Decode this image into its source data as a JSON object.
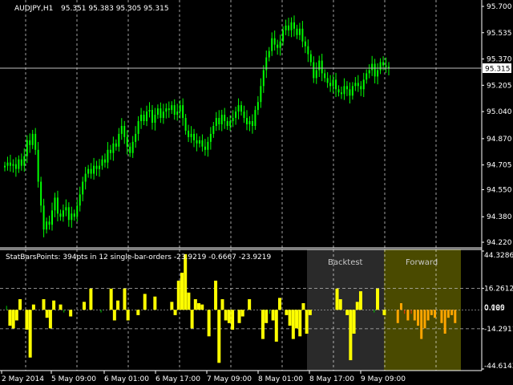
{
  "colors": {
    "background": "#000000",
    "candle": "#00ff00",
    "grid": "#ffffff",
    "axis_text": "#ffffff",
    "bar_yellow": "#ffff00",
    "bar_green": "#00cc00",
    "bar_orange": "#ffa500",
    "bar_red": "#ff3300",
    "backtest_zone": "#2a2a2a",
    "forward_zone": "#5a5a00",
    "bid_label_bg": "#ffffff",
    "bid_label_text": "#000000"
  },
  "header": {
    "symbol": "AUDJPY,H1",
    "ohlc": "95.351 95.383 95.305 95.315"
  },
  "indicator": {
    "caption": "StatBarsPoints: 394pts in 12 single-bar-orders -23.9219 -0.6667 -23.9219",
    "backtest_label": "Backtest",
    "forward_label": "Forward",
    "level_label_a": "0.000",
    "level_label_b": "0.185"
  },
  "price_axis": {
    "labels": [
      "95.700",
      "95.535",
      "95.370",
      "95.205",
      "95.040",
      "94.870",
      "94.705",
      "94.550",
      "94.380",
      "94.220"
    ],
    "bid_label": "95.315"
  },
  "indicator_axis": {
    "labels": [
      "44.3286",
      "16.2612",
      "-14.2911",
      "-44.6143"
    ]
  },
  "time_axis": {
    "labels": [
      "2 May 2014",
      "5 May 09:00",
      "6 May 01:00",
      "6 May 17:00",
      "7 May 09:00",
      "8 May 01:00",
      "8 May 17:00",
      "9 May 09:00"
    ]
  },
  "chart_data": {
    "type": "candlestick",
    "symbol": "AUDJPY",
    "timeframe": "H1",
    "price_range": [
      94.2,
      95.72
    ],
    "close_series": [
      94.7,
      94.72,
      94.7,
      94.71,
      94.68,
      94.74,
      94.7,
      94.76,
      94.86,
      94.83,
      94.9,
      94.8,
      94.6,
      94.45,
      94.3,
      94.35,
      94.33,
      94.42,
      94.5,
      94.4,
      94.38,
      94.42,
      94.44,
      94.36,
      94.4,
      94.38,
      94.45,
      94.52,
      94.6,
      94.65,
      94.68,
      94.65,
      94.7,
      94.68,
      94.7,
      94.74,
      94.72,
      94.8,
      94.78,
      94.84,
      94.82,
      94.9,
      94.95,
      94.88,
      94.82,
      94.78,
      94.85,
      94.9,
      94.98,
      95.02,
      94.98,
      95.04,
      95.05,
      94.97,
      95.02,
      95.06,
      95.0,
      95.04,
      95.06,
      95.05,
      95.08,
      95.02,
      95.04,
      95.08,
      95.0,
      94.92,
      94.88,
      94.9,
      94.86,
      94.84,
      94.86,
      94.82,
      94.8,
      94.85,
      94.9,
      94.95,
      95.0,
      94.96,
      95.02,
      94.98,
      94.95,
      94.98,
      95.0,
      95.04,
      95.08,
      95.04,
      95.0,
      94.96,
      94.98,
      94.95,
      95.05,
      95.1,
      95.2,
      95.3,
      95.38,
      95.42,
      95.5,
      95.46,
      95.44,
      95.48,
      95.55,
      95.58,
      95.55,
      95.6,
      95.56,
      95.52,
      95.56,
      95.48,
      95.45,
      95.4,
      95.35,
      95.25,
      95.3,
      95.36,
      95.28,
      95.25,
      95.22,
      95.2,
      95.24,
      95.18,
      95.16,
      95.15,
      95.2,
      95.18,
      95.14,
      95.2,
      95.22,
      95.2,
      95.18,
      95.24,
      95.28,
      95.3,
      95.34,
      95.26,
      95.3,
      95.35,
      95.33,
      95.32,
      95.31
    ],
    "indicator_bars": [
      0,
      3,
      -12,
      -14,
      -8,
      8,
      0,
      -15,
      -36,
      4,
      0,
      0,
      8,
      -6,
      -14,
      7,
      0,
      4,
      -2,
      0,
      -5,
      0,
      0,
      0,
      6,
      0,
      16,
      0,
      0,
      -2,
      0,
      0,
      16,
      -8,
      7,
      0,
      16,
      -8,
      0,
      0,
      -4,
      0,
      12,
      0,
      0,
      10,
      0,
      0,
      0,
      0,
      6,
      -4,
      22,
      28,
      42,
      13,
      -14,
      8,
      5,
      4,
      0,
      -20,
      0,
      22,
      -40,
      8,
      -8,
      -10,
      -15,
      0,
      -10,
      -5,
      0,
      8,
      0,
      0,
      0,
      -22,
      -10,
      -3,
      -8,
      -24,
      9,
      0,
      -4,
      -12,
      -22,
      -14,
      -20,
      5,
      -18,
      -4,
      0,
      0,
      0,
      0,
      0,
      0,
      0,
      16,
      8,
      0,
      -4,
      -38,
      -18,
      6,
      14,
      0,
      0,
      0,
      -2,
      16,
      0,
      -4,
      0,
      0,
      0,
      -10,
      5,
      -3,
      -8,
      -3,
      -8,
      -12,
      -22,
      -14,
      -8,
      -4,
      -6,
      0,
      -10,
      -18,
      -6,
      -4,
      -10,
      0
    ],
    "indicator_range": [
      -44.6143,
      44.3286
    ],
    "backtest_start_index": 90,
    "forward_start_index": 115
  }
}
